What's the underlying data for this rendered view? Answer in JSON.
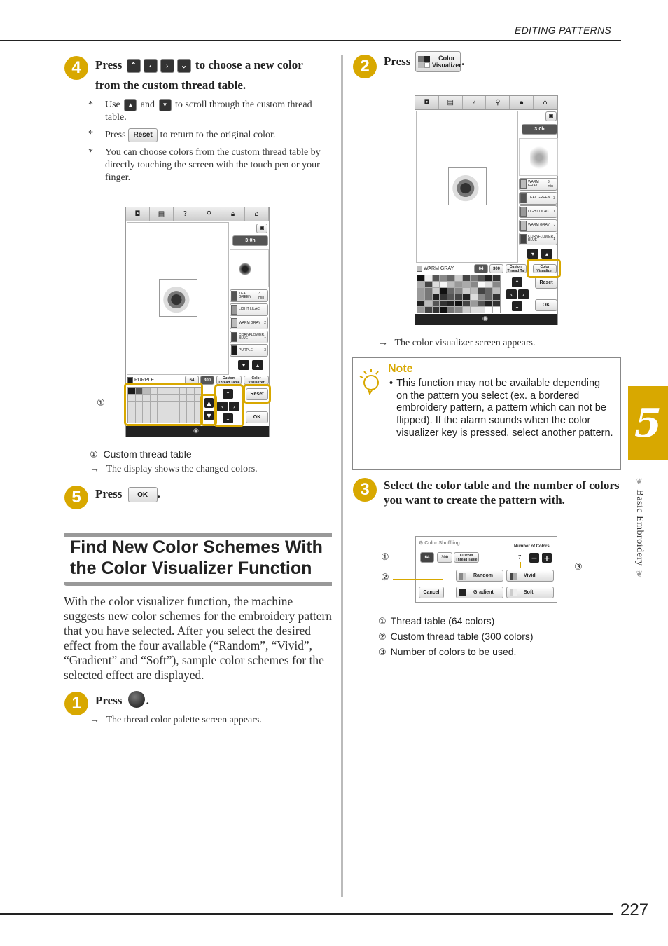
{
  "header": {
    "section_title": "EDITING PATTERNS"
  },
  "footer": {
    "page_number": "227"
  },
  "chapter_tab": {
    "number": "5",
    "label": "Basic Embroidery"
  },
  "left_column": {
    "step4": {
      "number": "4",
      "text_press": "Press",
      "nav_icons": [
        "up-arrow",
        "left-arrow",
        "right-arrow",
        "down-arrow"
      ],
      "text_rest_line1": "to choose a new color",
      "text_line2": "from the custom thread table.",
      "bullets": [
        {
          "pre": "Use",
          "mid": "and",
          "post": "to scroll through the custom thread",
          "cont": "table."
        },
        {
          "pre": "Press",
          "button": "Reset",
          "post": "to return to the original color."
        },
        {
          "text": "You can choose colors from the custom thread table by directly touching the screen with the touch pen or your finger."
        }
      ]
    },
    "screen1": {
      "toolbar_icons": [
        "camera",
        "document",
        "help",
        "presser-foot",
        "lock",
        "home"
      ],
      "time_label": "3:0h",
      "threads": [
        {
          "name": "TEAL GREEN",
          "count": "3",
          "sub": "min",
          "color": "#555555"
        },
        {
          "name": "LIGHT LILAC",
          "count": "1",
          "color": "#999999"
        },
        {
          "name": "WARM GRAY",
          "count": "2",
          "color": "#bbbbbb"
        },
        {
          "name": "CORNFLOWER BLUE",
          "count": "1",
          "color": "#444444"
        },
        {
          "name": "PURPLE",
          "count": "3",
          "color": "#1a1a1a"
        }
      ],
      "selected_thread": "PURPLE",
      "table_64": "64",
      "table_300": "300",
      "custom_thread_table": "Custom Thread Table",
      "color_visualizer": "Color Visualizer",
      "reset": "Reset",
      "ok": "OK",
      "palette_first_colors": [
        "#1a1a1a",
        "#555555",
        "#bbbbbb"
      ],
      "callout": "①"
    },
    "legend": [
      {
        "num": "①",
        "text": "Custom thread table"
      }
    ],
    "result_text": "The display shows the changed colors.",
    "step5": {
      "number": "5",
      "text_press": "Press",
      "button": "OK"
    },
    "section_heading": "Find New Color Schemes With the Color Visualizer Function",
    "intro": "With the color visualizer function, the machine suggests new color schemes for the embroidery pattern that you have selected. After you select the desired effect from the four available (“Random”, “Vivid”, “Gradient” and “Soft”), sample color schemes for the selected effect are displayed.",
    "step1": {
      "number": "1",
      "text_press": "Press",
      "result": "The thread color palette screen appears."
    }
  },
  "right_column": {
    "step2": {
      "number": "2",
      "text_press": "Press",
      "button_line1": "Color",
      "button_line2": "Visualizer"
    },
    "screen2": {
      "time_label": "3:0h",
      "threads": [
        {
          "name": "WARM GRAY",
          "count": "3",
          "sub": "min",
          "color": "#bbbbbb"
        },
        {
          "name": "TEAL GREEN",
          "count": "3",
          "color": "#555555"
        },
        {
          "name": "LIGHT LILAC",
          "count": "1",
          "color": "#999999"
        },
        {
          "name": "WARM GRAY",
          "count": "2",
          "color": "#bbbbbb"
        },
        {
          "name": "CORNFLOWER BLUE",
          "count": "1",
          "color": "#444444"
        }
      ],
      "selected_thread": "WARM GRAY",
      "table_64": "64",
      "table_300": "300",
      "custom_thread_table": "Custom Thread Tal",
      "color_visualizer": "Color Visualizer",
      "reset": "Reset",
      "ok": "OK"
    },
    "result_text": "The color visualizer screen appears.",
    "note": {
      "title": "Note",
      "text": "This function may not be available depending on the pattern you select (ex. a bordered embroidery pattern, a pattern which can not be flipped). If the alarm sounds when the color visualizer key is pressed, select another pattern."
    },
    "step3": {
      "number": "3",
      "text": "Select the color table and the number of colors you want to create the pattern with."
    },
    "color_shuffling": {
      "title": "Color Shuffling",
      "table_64": "64",
      "table_300": "300",
      "custom_thread_table": "Custom Thread Table",
      "number_of_colors_label": "Number of Colors",
      "number_of_colors_value": "7",
      "minus": "−",
      "plus": "+",
      "effects": [
        "Random",
        "Vivid",
        "Gradient",
        "Soft"
      ],
      "cancel": "Cancel",
      "callouts": [
        "①",
        "②",
        "③"
      ]
    },
    "legend": [
      {
        "num": "①",
        "text": "Thread table (64 colors)"
      },
      {
        "num": "②",
        "text": "Custom thread table (300 colors)"
      },
      {
        "num": "③",
        "text": "Number of colors to be used."
      }
    ]
  }
}
